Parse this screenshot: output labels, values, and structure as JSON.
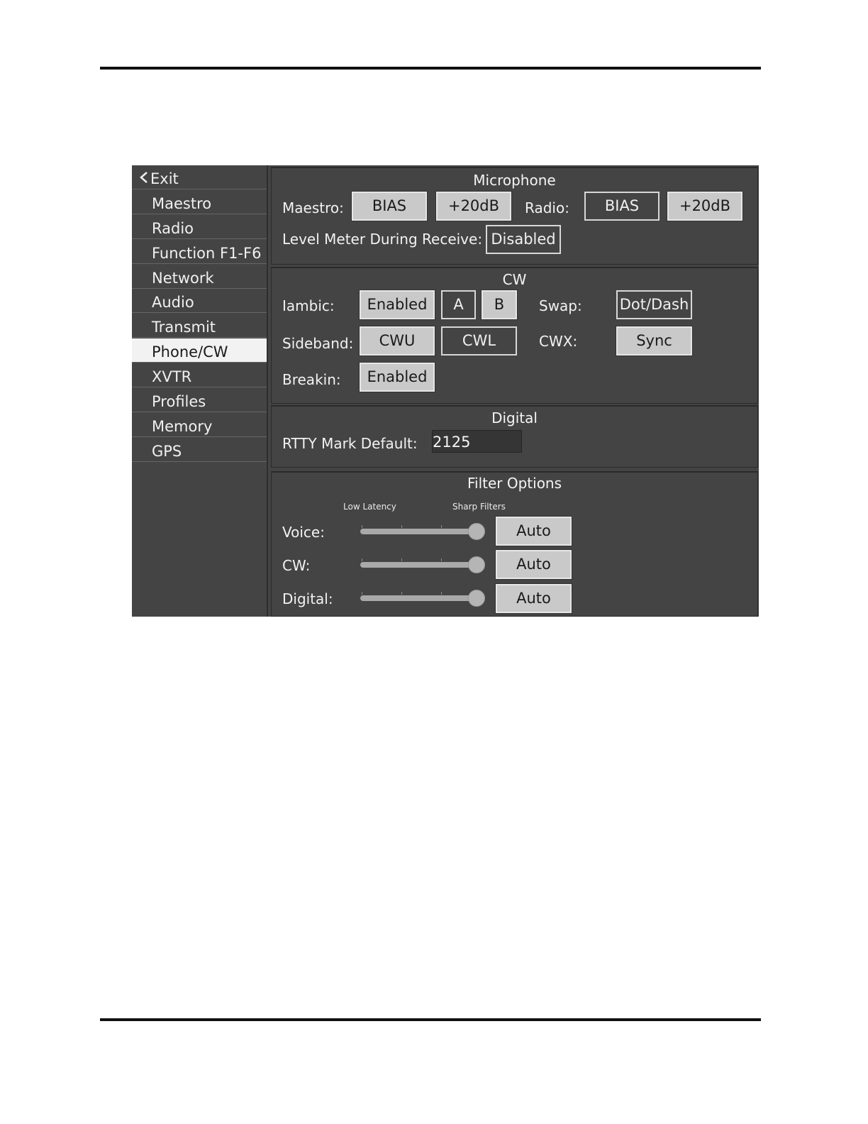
{
  "sidebar": {
    "exit_label": "Exit",
    "items": [
      "Maestro",
      "Radio",
      "Function F1-F6",
      "Network",
      "Audio",
      "Transmit",
      "Phone/CW",
      "XVTR",
      "Profiles",
      "Memory",
      "GPS"
    ],
    "active": "Phone/CW"
  },
  "microphone": {
    "title": "Microphone",
    "maestro_label": "Maestro:",
    "radio_label": "Radio:",
    "bias_label": "BIAS",
    "boost_label": "+20dB",
    "level_meter_label": "Level Meter During Receive:",
    "level_meter_value": "Disabled"
  },
  "cw": {
    "title": "CW",
    "iambic_label": "Iambic:",
    "iambic_value": "Enabled",
    "mode_a": "A",
    "mode_b": "B",
    "swap_label": "Swap:",
    "swap_value": "Dot/Dash",
    "sideband_label": "Sideband:",
    "cwu": "CWU",
    "cwl": "CWL",
    "cwx_label": "CWX:",
    "cwx_value": "Sync",
    "breakin_label": "Breakin:",
    "breakin_value": "Enabled"
  },
  "digital": {
    "title": "Digital",
    "rtty_label": "RTTY Mark Default:",
    "rtty_value": "2125"
  },
  "filter": {
    "title": "Filter Options",
    "low_latency": "Low Latency",
    "sharp_filters": "Sharp Filters",
    "rows": [
      {
        "label": "Voice:",
        "level": 1.0,
        "button": "Auto"
      },
      {
        "label": "CW:",
        "level": 1.0,
        "button": "Auto"
      },
      {
        "label": "Digital:",
        "level": 1.0,
        "button": "Auto"
      }
    ]
  },
  "colors": {
    "panel_bg": "#444444",
    "button_on": "#c9c9c9",
    "active_nav": "#f2f2f2"
  }
}
